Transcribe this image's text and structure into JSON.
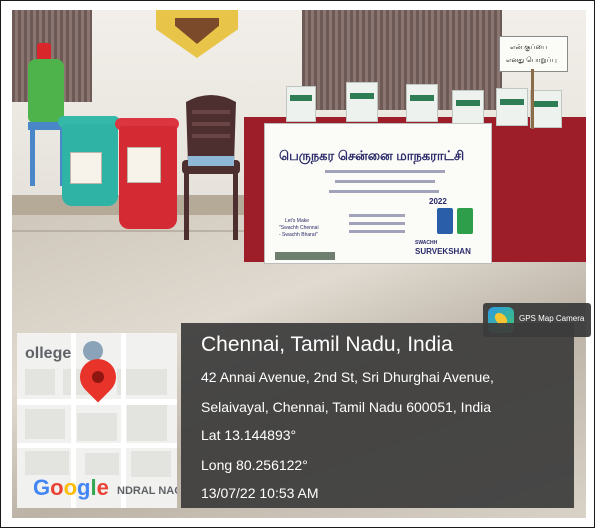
{
  "gps_badge": {
    "label": "GPS Map Camera",
    "icon": "gps-map-camera-icon"
  },
  "map": {
    "place_fragment": "ollege",
    "area_fragment": "NDRAL NAG",
    "logo": "Google",
    "logo_colors": [
      "#4285F4",
      "#EA4335",
      "#FBBC05",
      "#4285F4",
      "#34A853",
      "#EA4335"
    ],
    "pin_icon": "map-pin-icon"
  },
  "location": {
    "title": "Chennai, Tamil Nadu, India",
    "address_line1": "42 Annai Avenue, 2nd St, Sri Dhurghai Avenue,",
    "address_line2": "Selaivayal, Chennai, Tamil Nadu 600051, India",
    "lat": "Lat 13.144893°",
    "long": "Long 80.256122°",
    "datetime": "13/07/22 10:53 AM"
  },
  "banner": {
    "heading": "பெருநகர சென்னை மாநகராட்சி",
    "make_text": "Let's Make",
    "swachh_text": "\"Swachh Chennai",
    "bharat_text": "- Swachh Bharat\"",
    "year_text": "2022",
    "footer": "SURVEKSHAN",
    "footer_prefix": "SWACHH"
  },
  "sign": {
    "line1": "என் குப்பை",
    "line2": "எனது பொறுப்பு"
  },
  "colors": {
    "table_cloth": "#9d1d28",
    "overlay": "#3c3c3c",
    "bin_teal": "#2fb3a5",
    "bin_red": "#d32a34"
  }
}
